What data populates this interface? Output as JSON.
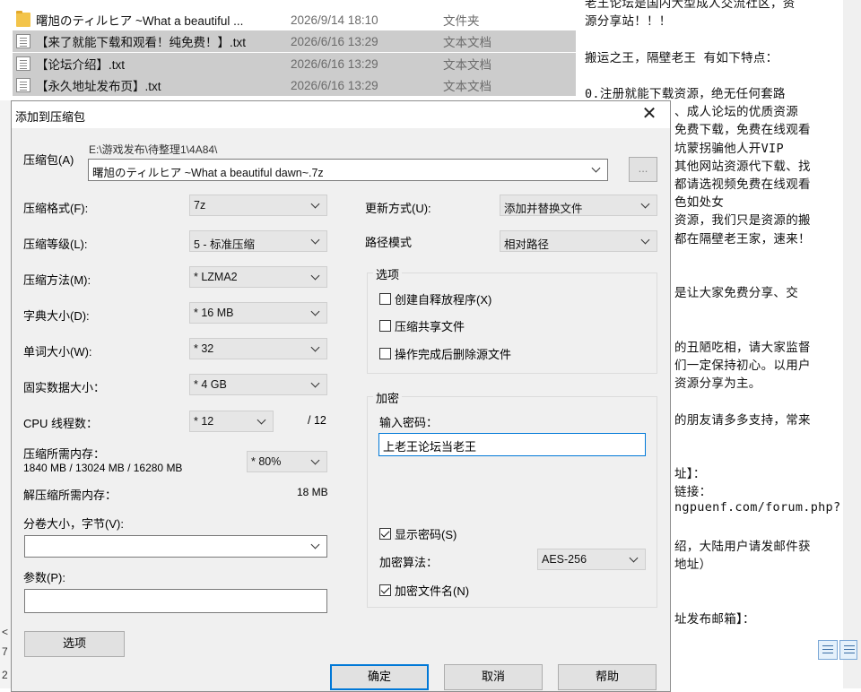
{
  "explorer": {
    "rows": [
      {
        "name": "曙旭のティルヒア ~What a beautiful ...",
        "date": "2026/9/14 18:10",
        "type": "文件夹",
        "icon": "folder-icon",
        "selected": false
      },
      {
        "name": "【来了就能下载和观看！纯免费！】.txt",
        "date": "2026/6/16 13:29",
        "type": "文本文档",
        "icon": "text-file-icon",
        "selected": true
      },
      {
        "name": "【论坛介绍】.txt",
        "date": "2026/6/16 13:29",
        "type": "文本文档",
        "icon": "text-file-icon",
        "selected": true
      },
      {
        "name": "【永久地址发布页】.txt",
        "date": "2026/6/16 13:29",
        "type": "文本文档",
        "icon": "text-file-icon",
        "selected": true
      }
    ]
  },
  "doc": {
    "lines": [
      "老王论坛是国内大型成人交流社区，资",
      "源分享站！！！",
      "",
      "搬运之王，隔壁老王 有如下特点：",
      "",
      "0.注册就能下载资源，绝无任何套路",
      "、成人论坛的优质资源",
      "免费下载，免费在线观看",
      "坑蒙拐骗他人开VIP",
      "其他网站资源代下载、找",
      "都请选视频免费在线观看",
      "色如处女",
      "资源，我们只是资源的搬",
      "都在隔壁老王家，速来！",
      "",
      "",
      "是让大家免费分享、交",
      "",
      "",
      "的丑陋吃相，请大家监督",
      "们一定保持初心。以用户",
      "资源分享为主。",
      "",
      "的朋友请多多支持，常来",
      "",
      "",
      "址】：",
      "链接：",
      "ngpuenf.com/forum.php?",
      "",
      "绍，大陆用户请发邮件获",
      "地址）",
      "",
      "",
      "址发布邮箱】："
    ]
  },
  "left_strip": {
    "chars": [
      "<",
      "7",
      "2"
    ]
  },
  "dialog": {
    "title": "添加到压缩包",
    "close": "✕",
    "archive": {
      "label": "压缩包(A)",
      "path": "E:\\游戏发布\\待整理1\\4A84\\",
      "name": "曙旭のティルヒア ~What a beautiful dawn~.7z",
      "browse": "..."
    },
    "left": {
      "format_label": "压缩格式(F):",
      "format": "7z",
      "level_label": "压缩等级(L):",
      "level": "5 - 标准压缩",
      "method_label": "压缩方法(M):",
      "method": "* LZMA2",
      "dict_label": "字典大小(D):",
      "dict": "* 16 MB",
      "word_label": "单词大小(W):",
      "word": "* 32",
      "solid_label": "固实数据大小：",
      "solid": "* 4 GB",
      "threads_label": "CPU 线程数：",
      "threads": "* 12",
      "threads_max": "/ 12",
      "mem_label": "压缩所需内存：",
      "mem_value": "1840 MB / 13024 MB / 16280 MB",
      "mem_percent": "* 80%",
      "decomp_label": "解压缩所需内存：",
      "decomp_value": "18 MB",
      "split_label": "分卷大小，字节(V):",
      "split": "",
      "params_label": "参数(P):",
      "params": "",
      "options_button": "选项"
    },
    "right": {
      "update_label": "更新方式(U):",
      "update": "添加并替换文件",
      "path_label": "路径模式",
      "path": "相对路径",
      "options_group": "选项",
      "opt_sfx": "创建自释放程序(X)",
      "opt_shared": "压缩共享文件",
      "opt_delete": "操作完成后删除源文件",
      "encrypt_group": "加密",
      "password_label": "输入密码：",
      "password": "上老王论坛当老王",
      "show_password": "显示密码(S)",
      "algo_label": "加密算法：",
      "algo": "AES-256",
      "encrypt_names": "加密文件名(N)"
    },
    "buttons": {
      "ok": "确定",
      "cancel": "取消",
      "help": "帮助"
    }
  }
}
